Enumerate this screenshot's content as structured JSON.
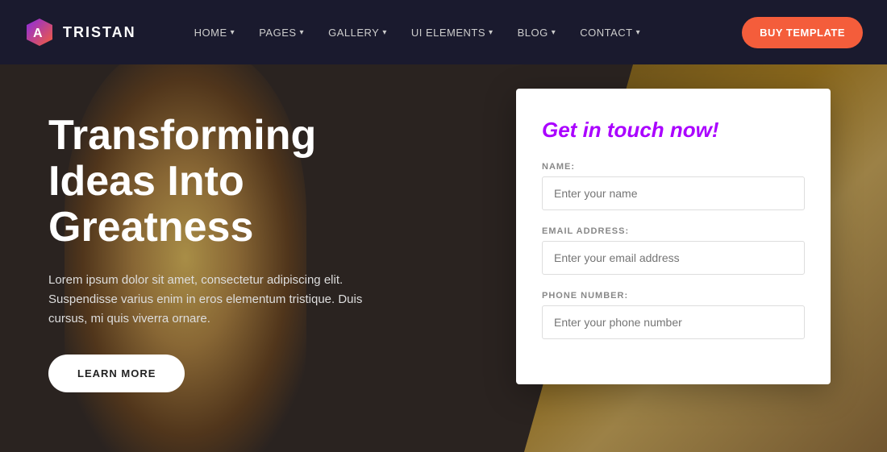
{
  "brand": {
    "name": "TRISTAN"
  },
  "navbar": {
    "links": [
      {
        "label": "HOME",
        "has_dropdown": true
      },
      {
        "label": "PAGES",
        "has_dropdown": true
      },
      {
        "label": "GALLERY",
        "has_dropdown": true
      },
      {
        "label": "UI ELEMENTS",
        "has_dropdown": true
      },
      {
        "label": "BLOG",
        "has_dropdown": true
      },
      {
        "label": "CONTACT",
        "has_dropdown": true
      }
    ],
    "cta_label": "BUY TEMPLATE"
  },
  "hero": {
    "title": "Transforming Ideas Into Greatness",
    "description": "Lorem ipsum dolor sit amet, consectetur adipiscing elit. Suspendisse varius enim in eros elementum tristique. Duis cursus, mi quis viverra ornare.",
    "cta_label": "LEARN MORE"
  },
  "form": {
    "title": "Get in touch now!",
    "fields": [
      {
        "label": "NAME:",
        "placeholder": "Enter your name",
        "type": "text",
        "name": "name-input"
      },
      {
        "label": "EMAIL ADDRESS:",
        "placeholder": "Enter your email address",
        "type": "email",
        "name": "email-input"
      },
      {
        "label": "PHONE NUMBER:",
        "placeholder": "Enter your phone number",
        "type": "tel",
        "name": "phone-input"
      }
    ]
  },
  "colors": {
    "accent_purple": "#aa00ff",
    "accent_orange": "#f45d3b",
    "nav_bg": "#1a1a2e"
  }
}
